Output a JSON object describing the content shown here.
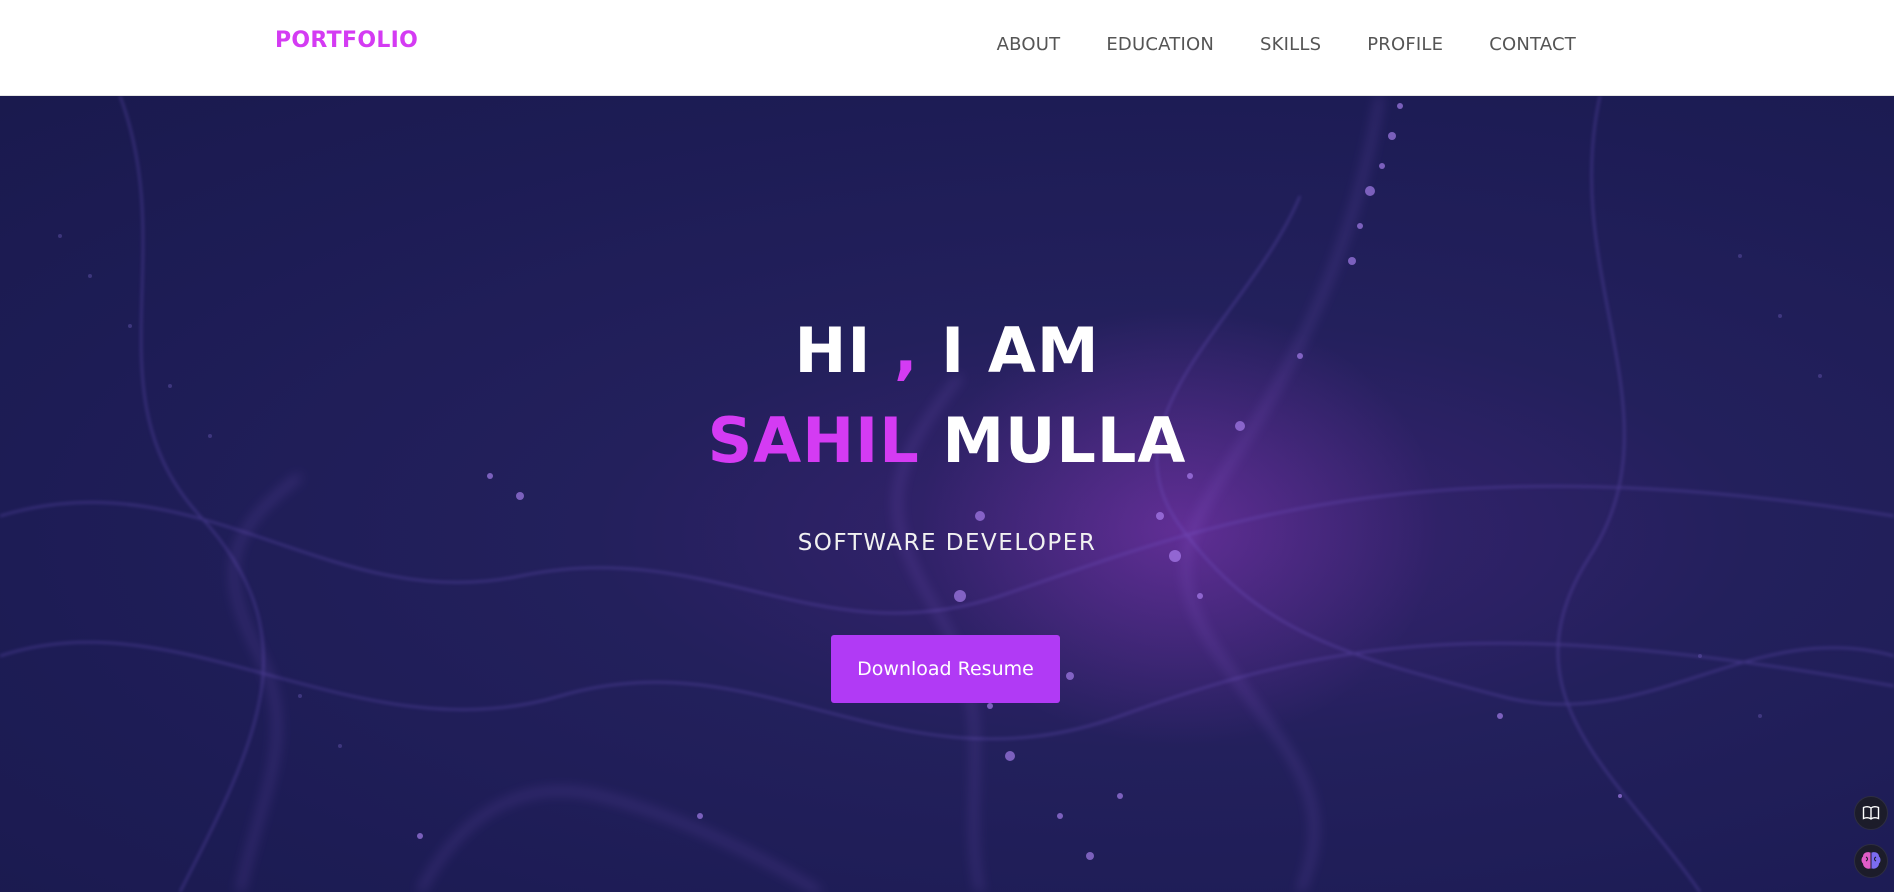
{
  "brand": {
    "label": "PORTFOLIO",
    "color": "#d43bf3"
  },
  "nav": {
    "items": [
      {
        "label": "ABOUT"
      },
      {
        "label": "EDUCATION"
      },
      {
        "label": "SKILLS"
      },
      {
        "label": "PROFILE"
      },
      {
        "label": "CONTACT"
      }
    ]
  },
  "hero": {
    "greeting_prefix": "HI ",
    "greeting_comma": ",",
    "greeting_suffix": " I AM",
    "first_name": "SAHIL",
    "last_name": "MULLA",
    "role": "SOFTWARE DEVELOPER",
    "cta_label": "Download Resume",
    "accent_color": "#d43bf3",
    "button_color": "#b13af5"
  },
  "floating_tools": {
    "reader_icon": "book-open-icon",
    "ai_icon": "brain-icon"
  }
}
